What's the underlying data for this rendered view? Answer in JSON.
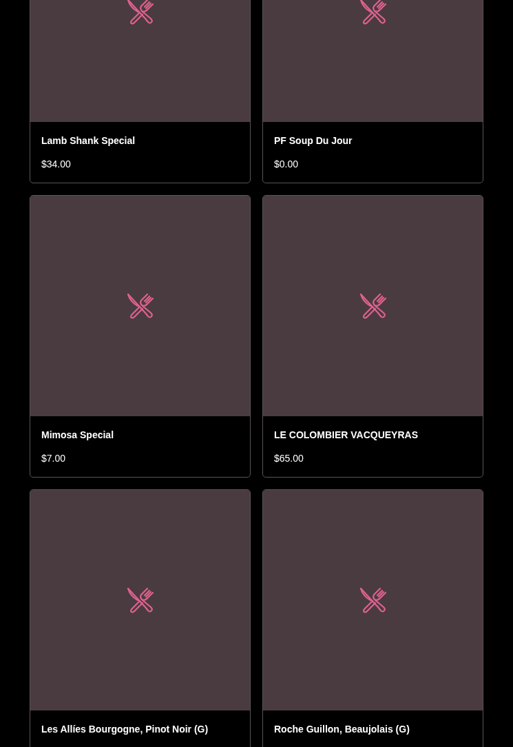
{
  "items": [
    {
      "name": "Lamb Shank Special",
      "price": "$34.00"
    },
    {
      "name": "PF Soup Du Jour",
      "price": "$0.00"
    },
    {
      "name": "Mimosa Special",
      "price": "$7.00"
    },
    {
      "name": "LE COLOMBIER VACQUEYRAS",
      "price": "$65.00"
    },
    {
      "name": "Les Allíes Bourgogne, Pinot Noir (G)"
    },
    {
      "name": "Roche Guillon, Beaujolais (G)"
    }
  ]
}
